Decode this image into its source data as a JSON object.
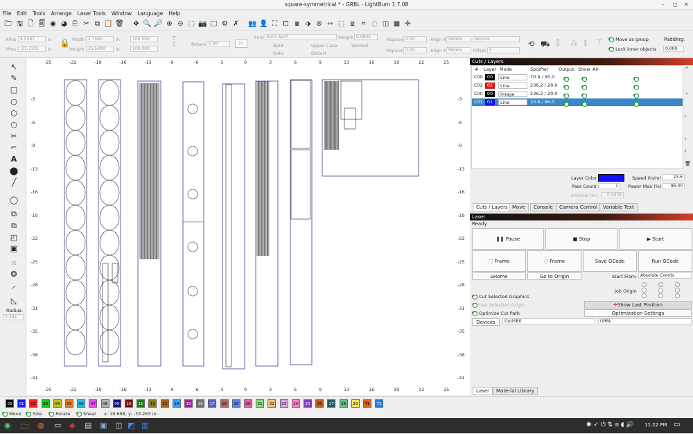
{
  "window": {
    "title": "square-symmetrical * - GRBL - LightBurn 1.7.08",
    "min": "–",
    "max": "◻",
    "close": "✕"
  },
  "menu": [
    "File",
    "Edit",
    "Tools",
    "Arrange",
    "Laser Tools",
    "Window",
    "Language",
    "Help"
  ],
  "props": {
    "xpos_label": "XPos",
    "xpos": "6.5387",
    "ypos_label": "YPos",
    "ypos": "-21.7131",
    "unit": "in",
    "width_label": "Width",
    "width": "2.7560",
    "height_label": "Height",
    "height": "35.5000",
    "pct1": "100.000",
    "pct2": "100.000",
    "rotate_label": "Rotate",
    "rotate": "0.00",
    "in_btn": "in",
    "font_label": "Font",
    "font": "Sans Serif",
    "height2_label": "Height",
    "height2": "0.9843",
    "hspace_label": "HSpace",
    "hspace": "0.00",
    "vspace_label": "VSpace",
    "vspace": "0.00",
    "alignx_label": "Align X",
    "alignx": "Middle",
    "aligny_label": "Align Y",
    "aligny": "Middle",
    "normal": "Normal",
    "offset_label": "Offset",
    "offset": "0",
    "bold": "Bold",
    "italic": "Italic",
    "uppercase": "Upper Case",
    "distort": "Distort",
    "welded": "Welded",
    "move_as_group": "Move as group",
    "lock_inner": "Lock inner objects",
    "padding_label": "Padding:",
    "padding": "0.000"
  },
  "left_tools": {
    "radius_label": "Radius:",
    "radius": "0.394"
  },
  "ruler": {
    "top": [
      "-25",
      "-22",
      "-19",
      "-16",
      "-13",
      "-9",
      "-6",
      "-3",
      "0",
      "3",
      "6",
      "9",
      "13",
      "16",
      "19",
      "22",
      "25"
    ],
    "left": [
      "-3",
      "-6",
      "-9",
      "-13",
      "-16",
      "-19",
      "-22",
      "-25",
      "-28",
      "-31",
      "-35",
      "-38",
      "-41"
    ],
    "right": [
      "-3",
      "-6",
      "-9",
      "-13",
      "-16",
      "-19",
      "-22",
      "-25",
      "-28",
      "-31",
      "-35",
      "-38",
      "-41"
    ]
  },
  "cuts": {
    "header": "Cuts / Layers",
    "cols": [
      "#",
      "Layer",
      "Mode",
      "Spd/Pwr",
      "Output",
      "Show",
      "Air"
    ],
    "rows": [
      {
        "num": "C00",
        "layer": "00",
        "color": "#000000",
        "mode": "Line",
        "spd": "70.9 / 95.0"
      },
      {
        "num": "C02",
        "layer": "02",
        "color": "#e01010",
        "mode": "Line",
        "spd": "236.2 / 20.0"
      },
      {
        "num": "C00",
        "layer": "00",
        "color": "#000000",
        "mode": "Image",
        "spd": "236.2 / 20.0"
      },
      {
        "num": "C01",
        "layer": "01",
        "color": "#1010e0",
        "mode": "Line",
        "spd": "23.6 / 86.0"
      }
    ],
    "layer_color_label": "Layer Color",
    "speed_label": "Speed (in/m)",
    "speed": "23.6",
    "pass_label": "Pass Count",
    "pass": "1",
    "power_label": "Power Max (%)",
    "power": "86.00",
    "interval_label": "Interval (in)",
    "interval": "0.0039",
    "tabs": [
      "Cuts / Layers",
      "Move",
      "Console",
      "Camera Control",
      "Variable Text"
    ]
  },
  "laser": {
    "header": "Laser",
    "status": "Ready",
    "pause": "Pause",
    "stop": "Stop",
    "start": "Start",
    "frame1": "Frame",
    "frame2": "Frame",
    "save_gcode": "Save GCode",
    "run_gcode": "Run GCode",
    "home": "Home",
    "go_origin": "Go to Origin",
    "start_from_label": "Start From:",
    "start_from": "Absolute Coords",
    "job_origin_label": "Job Origin",
    "cut_selected": "Cut Selected Graphics",
    "use_selection": "Use Selection Origin",
    "optimize": "Optimize Cut Path",
    "show_last": "Show Last Position",
    "opt_settings": "Optimization Settings",
    "devices": "Devices",
    "port": "ttyUSB0",
    "device": "GRBL",
    "bottom_tabs": [
      "Laser",
      "Material Library"
    ]
  },
  "palette": [
    {
      "l": "00",
      "c": "#000000",
      "t": "#fff"
    },
    {
      "l": "01",
      "c": "#1a1aff",
      "t": "#fff"
    },
    {
      "l": "02",
      "c": "#ff2020",
      "t": "#000"
    },
    {
      "l": "03",
      "c": "#20c020",
      "t": "#000"
    },
    {
      "l": "04",
      "c": "#c0c020",
      "t": "#000"
    },
    {
      "l": "05",
      "c": "#e08020",
      "t": "#000"
    },
    {
      "l": "06",
      "c": "#20c0e0",
      "t": "#000"
    },
    {
      "l": "07",
      "c": "#ff40ff",
      "t": "#000"
    },
    {
      "l": "08",
      "c": "#b0b0b0",
      "t": "#000"
    },
    {
      "l": "09",
      "c": "#101080",
      "t": "#fff"
    },
    {
      "l": "10",
      "c": "#801010",
      "t": "#fff"
    },
    {
      "l": "11",
      "c": "#108010",
      "t": "#fff"
    },
    {
      "l": "12",
      "c": "#808010",
      "t": "#000"
    },
    {
      "l": "13",
      "c": "#b06010",
      "t": "#000"
    },
    {
      "l": "14",
      "c": "#30a0ff",
      "t": "#000"
    },
    {
      "l": "15",
      "c": "#a020a0",
      "t": "#fff"
    },
    {
      "l": "16",
      "c": "#707070",
      "t": "#fff"
    },
    {
      "l": "17",
      "c": "#6060c0",
      "t": "#fff"
    },
    {
      "l": "18",
      "c": "#c06060",
      "t": "#000"
    },
    {
      "l": "19",
      "c": "#6080ff",
      "t": "#000"
    },
    {
      "l": "20",
      "c": "#e060a0",
      "t": "#000"
    },
    {
      "l": "21",
      "c": "#80e080",
      "t": "#000"
    },
    {
      "l": "22",
      "c": "#f0c080",
      "t": "#000"
    },
    {
      "l": "23",
      "c": "#e0a0e0",
      "t": "#000"
    },
    {
      "l": "24",
      "c": "#ff80c0",
      "t": "#000"
    },
    {
      "l": "25",
      "c": "#8040c0",
      "t": "#fff"
    },
    {
      "l": "26",
      "c": "#c06020",
      "t": "#000"
    },
    {
      "l": "27",
      "c": "#206060",
      "t": "#fff"
    },
    {
      "l": "28",
      "c": "#60c080",
      "t": "#000"
    },
    {
      "l": "29",
      "c": "#f0e060",
      "t": "#000"
    },
    {
      "l": "T1",
      "c": "#e06020",
      "t": "#000"
    },
    {
      "l": "T2",
      "c": "#2080e0",
      "t": "#fff"
    }
  ],
  "status": {
    "move": "Move",
    "size": "Size",
    "rotate": "Rotate",
    "shear": "Shear",
    "coords": "x: 19.698, y: -33.263 in"
  },
  "taskbar": {
    "time": "11:22 PM"
  }
}
